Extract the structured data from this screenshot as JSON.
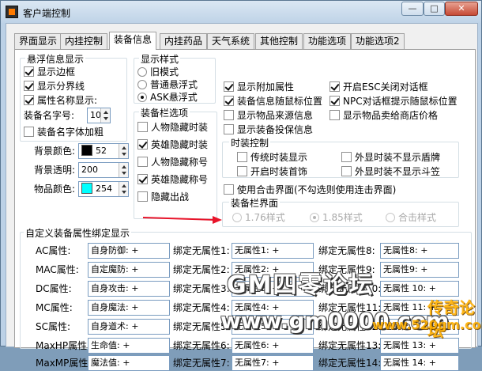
{
  "window": {
    "title": "客户端控制",
    "minimize": "—",
    "maximize": "□",
    "close": "✕"
  },
  "tabs": [
    "界面显示",
    "内挂控制",
    "装备信息",
    "内挂药品",
    "天气系统",
    "其他控制",
    "功能选项",
    "功能选项2"
  ],
  "float_info": {
    "legend": "悬浮信息显示",
    "show_border": "显示边框",
    "show_divider": "显示分界线",
    "attr_name_display": "属性名称显示:",
    "font_size_label": "装备名字号:",
    "font_size_value": "10",
    "bold_name": "装备名字体加粗"
  },
  "display_style": {
    "legend": "显示样式",
    "old_mode": "旧模式",
    "normal_float": "普通悬浮式",
    "ask_float": "ASK悬浮式"
  },
  "colors": {
    "bg_label": "背景颜色:",
    "bg_value": "52",
    "bg_swatch": "#000000",
    "alpha_label": "背景透明:",
    "alpha_value": "200",
    "item_label": "物品颜色:",
    "item_value": "254",
    "item_swatch": "#00ffff"
  },
  "equip_options": {
    "legend": "装备栏选项",
    "hide_costume": "人物隐藏时装",
    "hero_hide_costume": "英雄隐藏时装",
    "hide_title": "人物隐藏称号",
    "hero_hide_title": "英雄隐藏称号",
    "hide_battle": "隐藏出战"
  },
  "right_options": {
    "show_extra_attr": "显示附加属性",
    "open_esc": "开启ESC关闭对话框",
    "follow_mouse": "装备信息随鼠标位置",
    "npc_follow": "NPC对话框提示随鼠标位置",
    "show_source": "显示物品来源信息",
    "show_shop_price": "显示物品卖给商店价格",
    "show_insurance": "显示装备投保信息"
  },
  "costume": {
    "legend": "时装控制",
    "traditional": "传统时装显示",
    "hide_shield": "外显时装不显示盾牌",
    "costume_jewelry": "开启时装首饰",
    "hide_cape": "外显时装不显示斗笠"
  },
  "merge_ui": {
    "label": "使用合击界面(不勾选则使用连击界面)",
    "legend": "装备栏界面",
    "style176": "1.76样式",
    "style185": "1.85样式",
    "merge_style": "合击样式"
  },
  "custom_attr": {
    "legend": "自定义装备属性绑定显示",
    "rows": [
      {
        "label": "AC属性:",
        "value": "自身防御: +",
        "b1": "绑定无属性1:",
        "v1": "无属性1: +",
        "b2": "绑定无属性8:",
        "v2": "无属性8: +"
      },
      {
        "label": "MAC属性:",
        "value": "自定魔防: +",
        "b1": "绑定无属性2:",
        "v1": "无属性2: +",
        "b2": "绑定无属性9:",
        "v2": "无属性9: +"
      },
      {
        "label": "DC属性:",
        "value": "自身攻击: +",
        "b1": "绑定无属性3:",
        "v1": "无属性3: +",
        "b2": "绑定无属性10:",
        "v2": "无属性 10: +"
      },
      {
        "label": "MC属性:",
        "value": "自身魔法: +",
        "b1": "绑定无属性4:",
        "v1": "无属性4: +",
        "b2": "绑定无属性11:",
        "v2": "无属性 11: +"
      },
      {
        "label": "SC属性:",
        "value": "自身道术: +",
        "b1": "绑定无属性5:",
        "v1": "无属性5: +",
        "b2": "绑定无属性12:",
        "v2": "无属性 12: +"
      },
      {
        "label": "MaxHP属性:",
        "value": "生命值: +",
        "b1": "绑定无属性6:",
        "v1": "无属性6: +",
        "b2": "绑定无属性13:",
        "v2": "无属性 13: +"
      },
      {
        "label": "MaxMP属性:",
        "value": "魔法值: +",
        "b1": "绑定无属性7:",
        "v1": "无属性7: +",
        "b2": "绑定无属性14:",
        "v2": "无属性 14: +"
      }
    ]
  },
  "watermark": {
    "line1": "GM四零论坛",
    "line2": "www.gm0000.com",
    "line3": "传奇论坛",
    "line4": "www.520gm.com"
  },
  "accent": {
    "arrow": "#e8142a"
  }
}
